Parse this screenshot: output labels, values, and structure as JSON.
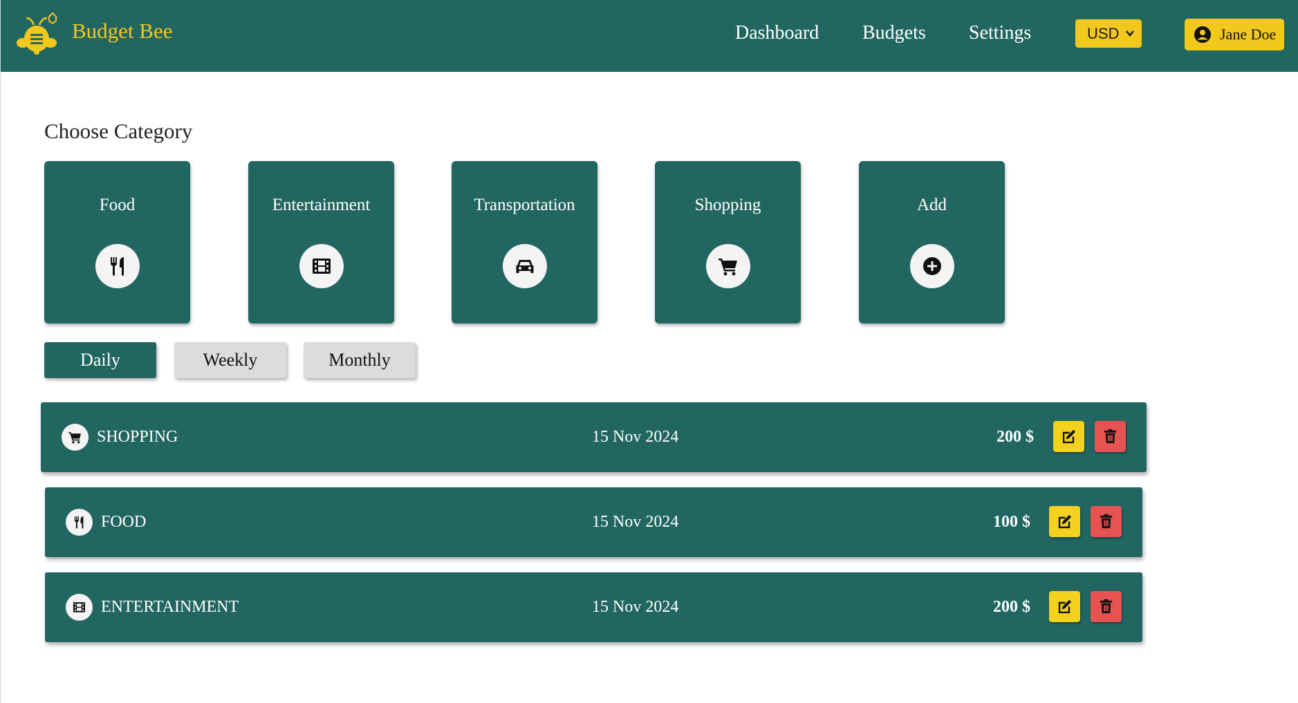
{
  "header": {
    "brand": "Budget Bee",
    "nav": [
      "Dashboard",
      "Budgets",
      "Settings"
    ],
    "currency": "USD",
    "user": "Jane Doe",
    "colors": {
      "primary": "#226661",
      "accent": "#f2c81d",
      "danger": "#e55353"
    }
  },
  "categories": {
    "title": "Choose Category",
    "items": [
      {
        "label": "Food",
        "icon": "utensils-icon"
      },
      {
        "label": "Entertainment",
        "icon": "film-icon"
      },
      {
        "label": "Transportation",
        "icon": "car-icon"
      },
      {
        "label": "Shopping",
        "icon": "cart-icon"
      },
      {
        "label": "Add",
        "icon": "plus-circle-icon"
      }
    ]
  },
  "periods": {
    "items": [
      "Daily",
      "Weekly",
      "Monthly"
    ],
    "active": "Daily"
  },
  "expenses": [
    {
      "category": "SHOPPING",
      "date": "15 Nov 2024",
      "amount": "200 $",
      "icon": "cart-icon"
    },
    {
      "category": "FOOD",
      "date": "15 Nov 2024",
      "amount": "100 $",
      "icon": "utensils-icon"
    },
    {
      "category": "ENTERTAINMENT",
      "date": "15 Nov 2024",
      "amount": "200 $",
      "icon": "film-icon"
    }
  ]
}
